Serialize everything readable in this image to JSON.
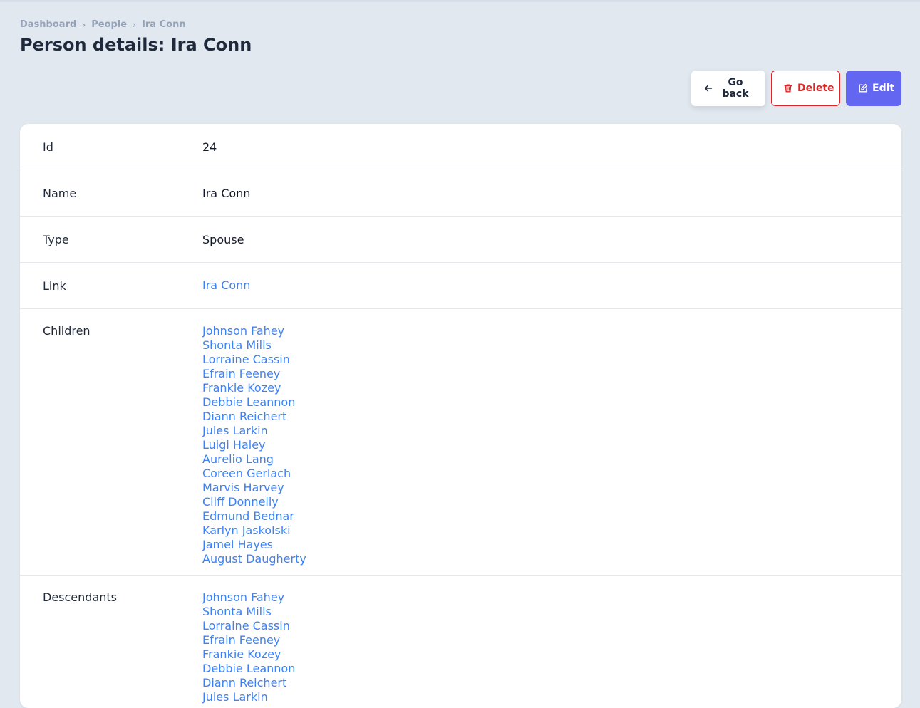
{
  "breadcrumb": {
    "items": [
      "Dashboard",
      "People",
      "Ira Conn"
    ]
  },
  "page_title": "Person details: Ira Conn",
  "actions": {
    "back_label": "Go back",
    "delete_label": "Delete",
    "edit_label": "Edit"
  },
  "fields": {
    "id": {
      "label": "Id",
      "value": "24"
    },
    "name": {
      "label": "Name",
      "value": "Ira Conn"
    },
    "type": {
      "label": "Type",
      "value": "Spouse"
    },
    "link": {
      "label": "Link",
      "value": "Ira Conn"
    },
    "children": {
      "label": "Children",
      "items": [
        "Johnson Fahey",
        "Shonta Mills",
        "Lorraine Cassin",
        "Efrain Feeney",
        "Frankie Kozey",
        "Debbie Leannon",
        "Diann Reichert",
        "Jules Larkin",
        "Luigi Haley",
        "Aurelio Lang",
        "Coreen Gerlach",
        "Marvis Harvey",
        "Cliff Donnelly",
        "Edmund Bednar",
        "Karlyn Jaskolski",
        "Jamel Hayes",
        "August Daugherty"
      ]
    },
    "descendants": {
      "label": "Descendants",
      "items": [
        "Johnson Fahey",
        "Shonta Mills",
        "Lorraine Cassin",
        "Efrain Feeney",
        "Frankie Kozey",
        "Debbie Leannon",
        "Diann Reichert",
        "Jules Larkin"
      ]
    }
  },
  "colors": {
    "accent": "#6366f1",
    "danger": "#dc2626",
    "link": "#3b82f6",
    "background": "#e2e8f0"
  }
}
